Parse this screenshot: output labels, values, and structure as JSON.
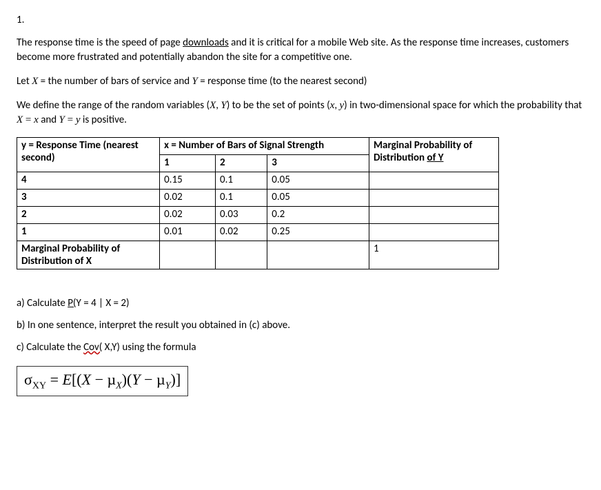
{
  "qnum": "1.",
  "p1a": "The response time is the speed of page ",
  "p1_link": "downloads",
  "p1b": " and it is critical for a mobile Web site. As the response time increases, customers become more frustrated and potentially abandon the site for a competitive one.",
  "p2a": "Let ",
  "p2_X": "X",
  "p2b": " = the number of bars of service and ",
  "p2_Y": "Y",
  "p2c": " = response time (to the nearest second)",
  "p3a": "We define the range of the random variables (",
  "p3_X": "X",
  "p3_comma": ", ",
  "p3_Y": "Y",
  "p3b": ") to be the set of points (",
  "p3_x": "x",
  "p3_comma2": ", ",
  "p3_y": "y",
  "p3c": ") in two-dimensional space for which the probability that ",
  "p3_X2": "X",
  "p3_eq1": "  =  ",
  "p3_x2": "x",
  "p3_and": " and ",
  "p3_Y2": "Y",
  "p3_eq2": "  =  ",
  "p3_y2": "y",
  "p3d": " is positive.",
  "table": {
    "hdr_y": "y = Response Time (nearest second)",
    "hdr_x": "x = Number of Bars of Signal Strength",
    "hdr_marg": "Marginal Probability of Distribution ",
    "hdr_marg_link": "of  Y",
    "sub_1": "1",
    "sub_2": "2",
    "sub_3": "3",
    "rows": [
      {
        "y": "4",
        "c1": "0.15",
        "c2": "0.1",
        "c3": "0.05",
        "m": ""
      },
      {
        "y": "3",
        "c1": "0.02",
        "c2": "0.1",
        "c3": "0.05",
        "m": ""
      },
      {
        "y": "2",
        "c1": "0.02",
        "c2": "0.03",
        "c3": "0.2",
        "m": ""
      },
      {
        "y": "1",
        "c1": "0.01",
        "c2": "0.02",
        "c3": "0.25",
        "m": ""
      }
    ],
    "footer_label": "Marginal Probability of Distribution of X",
    "footer_c1": "",
    "footer_c2": "",
    "footer_c3": "",
    "footer_total": "1"
  },
  "qa_pre": "a) Calculate ",
  "qa_link": "P(",
  "qa_post": "Y = 4 | X = 2)",
  "qb": "b) In one sentence, interpret the result you obtained in (c) above.",
  "qc_pre": "c) Calculate the ",
  "qc_wavy": "Cov(",
  "qc_post": " X,Y) using the formula",
  "formula": {
    "sigma": "σ",
    "sub_xy": "XY",
    "eq": " = ",
    "E": "E",
    "lb": "[(",
    "X": "X",
    "minus1": " − µ",
    "sub_x": "X",
    "close1": ")(",
    "Y": "Y",
    "minus2": " − µ",
    "sub_y": "Y",
    "close2": ")]"
  }
}
